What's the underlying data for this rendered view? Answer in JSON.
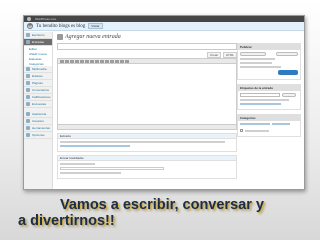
{
  "admin_bar": {
    "site_label": "WordPress.com",
    "user_label": "Mi cuenta"
  },
  "header": {
    "site_title": "Tu bendito blogs es blog",
    "visit_label": "Visitar"
  },
  "sidebar": {
    "items": [
      {
        "label": "Escritorio",
        "name": "sidebar-item-escritorio",
        "active": false,
        "sub": false
      },
      {
        "label": "Entradas",
        "name": "sidebar-item-entradas",
        "active": true,
        "sub": false
      },
      {
        "label": "Editar",
        "name": "sidebar-item-editar",
        "active": false,
        "sub": true
      },
      {
        "label": "Añadir nueva",
        "name": "sidebar-item-anadir-nueva",
        "active": false,
        "sub": true
      },
      {
        "label": "Etiquetas",
        "name": "sidebar-item-etiquetas",
        "active": false,
        "sub": true
      },
      {
        "label": "Categorías",
        "name": "sidebar-item-categorias",
        "active": false,
        "sub": true
      },
      {
        "label": "Multimedia",
        "name": "sidebar-item-multimedia",
        "active": false,
        "sub": false
      },
      {
        "label": "Enlaces",
        "name": "sidebar-item-enlaces",
        "active": false,
        "sub": false
      },
      {
        "label": "Páginas",
        "name": "sidebar-item-paginas",
        "active": false,
        "sub": false
      },
      {
        "label": "Comentarios",
        "name": "sidebar-item-comentarios",
        "active": false,
        "sub": false
      },
      {
        "label": "Calificaciones",
        "name": "sidebar-item-calificaciones",
        "active": false,
        "sub": false
      },
      {
        "label": "Encuestas",
        "name": "sidebar-item-encuestas",
        "active": false,
        "sub": false
      },
      {
        "label": "Apariencia",
        "name": "sidebar-item-apariencia",
        "active": false,
        "sub": false
      },
      {
        "label": "Usuarios",
        "name": "sidebar-item-usuarios",
        "active": false,
        "sub": false
      },
      {
        "label": "Herramientas",
        "name": "sidebar-item-herramientas",
        "active": false,
        "sub": false
      },
      {
        "label": "Opciones",
        "name": "sidebar-item-opciones",
        "active": false,
        "sub": false
      }
    ]
  },
  "main": {
    "page_title": "Agregar nueva entrada",
    "mode_tabs": {
      "visual": "Visual",
      "html": "HTML"
    },
    "excerpt_label": "Extracto",
    "trackbacks_label": "Enviar trackbacks"
  },
  "right": {
    "publish": {
      "heading": "Publicar",
      "button": "Publicar"
    },
    "tags": {
      "heading": "Etiquetas de la entrada",
      "button": "Añadir"
    },
    "categories": {
      "heading": "Categorías",
      "uncategorized": "Uncategorized"
    }
  },
  "caption": {
    "line1": "Vamos a escribir, conversar y",
    "line2": "a divertirnos!!"
  },
  "colors": {
    "caption_text": "#1a2d4f",
    "caption_shadow": "#d4b24a",
    "admin_bar": "#464646",
    "accent": "#21759b"
  }
}
